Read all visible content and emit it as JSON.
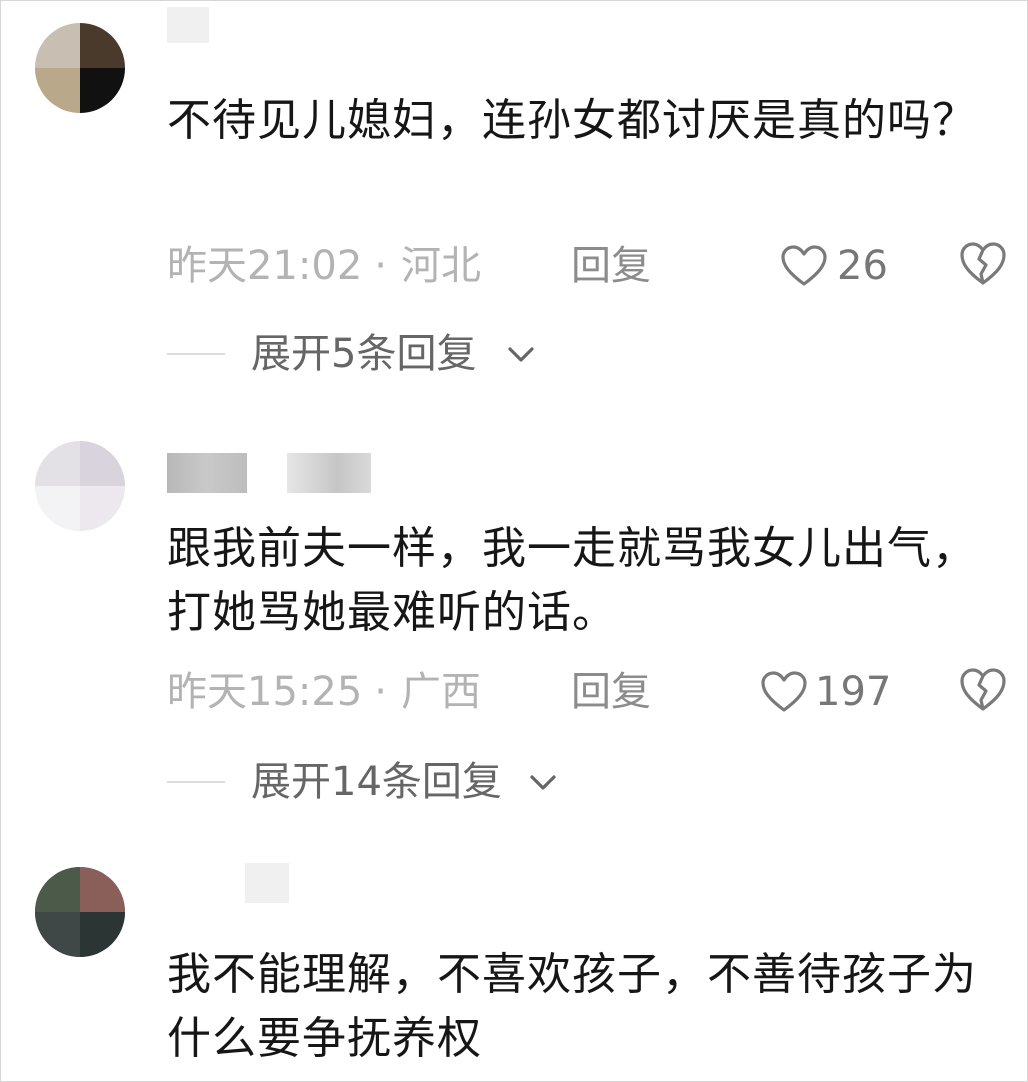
{
  "comments": [
    {
      "text": "不待见儿媳妇，连孙女都讨厌是真的吗？",
      "time": "昨天21:02",
      "location": "河北",
      "reply_label": "回复",
      "likes": "26",
      "expand_label": "展开5条回复"
    },
    {
      "text": "跟我前夫一样，我一走就骂我女儿出气，打她骂她最难听的话。",
      "time": "昨天15:25",
      "location": "广西",
      "reply_label": "回复",
      "likes": "197",
      "expand_label": "展开14条回复"
    },
    {
      "text": "我不能理解，不喜欢孩子，不善待孩子为什么要争抚养权"
    }
  ],
  "separator": "·",
  "icons": {
    "like": "heart-outline-icon",
    "dislike": "broken-heart-icon",
    "expand": "chevron-down-icon"
  },
  "colors": {
    "text": "#161616",
    "meta": "#b3b3b3",
    "reply": "#8c8c8c",
    "expand": "#666666"
  }
}
